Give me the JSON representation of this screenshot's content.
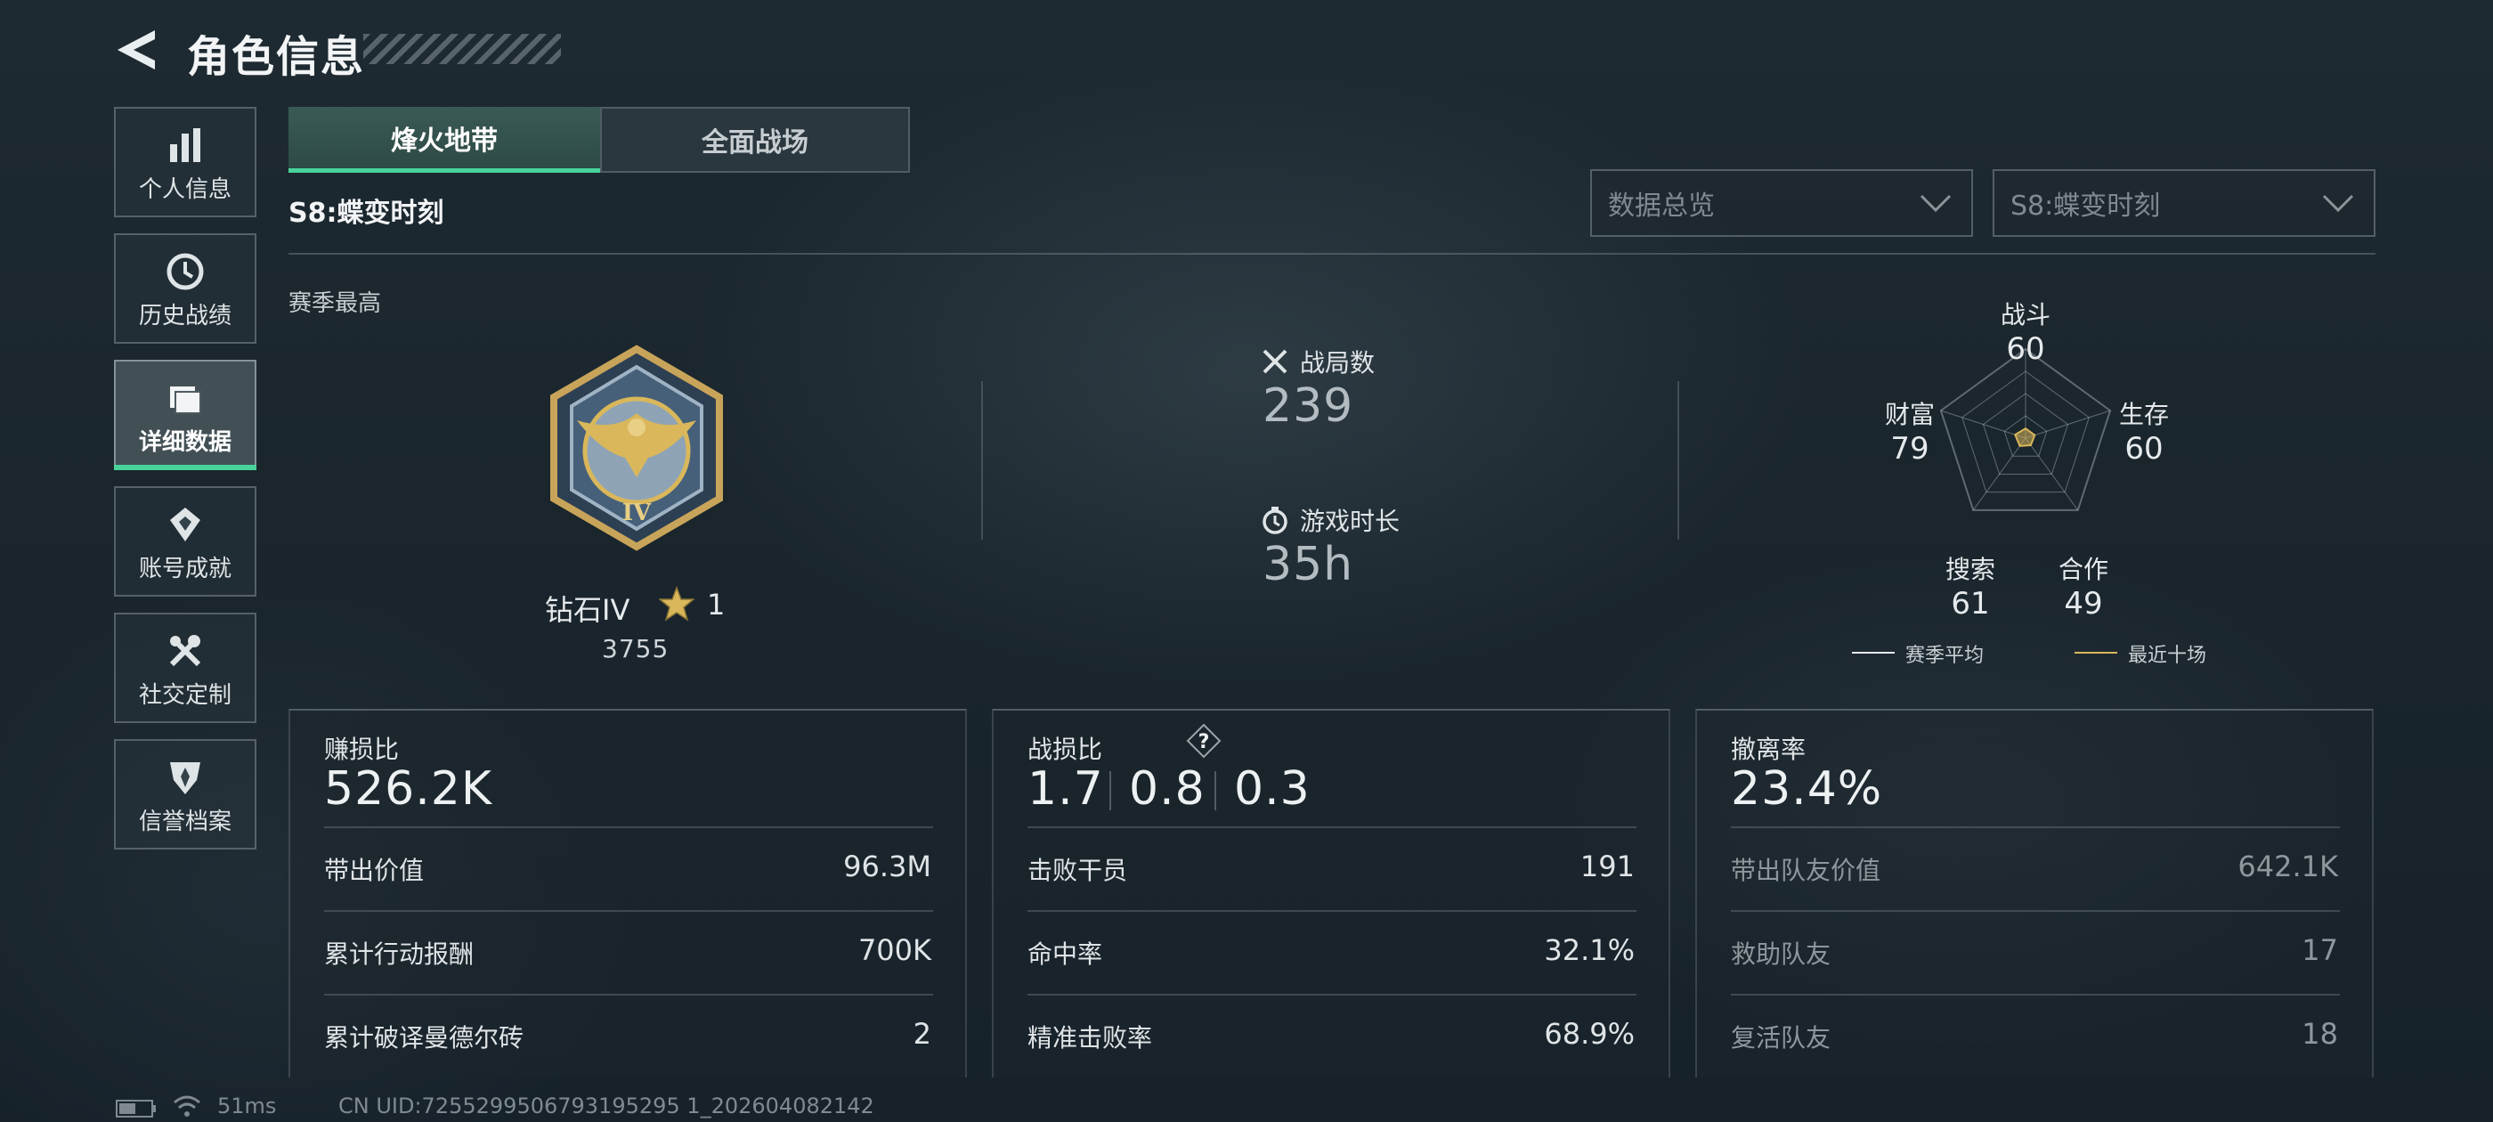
{
  "header": {
    "title": "角色信息"
  },
  "sidebar": {
    "items": [
      {
        "label": "个人信息",
        "icon": "bar-chart-icon"
      },
      {
        "label": "历史战绩",
        "icon": "history-icon"
      },
      {
        "label": "详细数据",
        "icon": "folder-icon",
        "active": true
      },
      {
        "label": "账号成就",
        "icon": "achievement-icon"
      },
      {
        "label": "社交定制",
        "icon": "tools-icon"
      },
      {
        "label": "信誉档案",
        "icon": "reputation-icon"
      }
    ]
  },
  "tabs": [
    {
      "label": "烽火地带",
      "active": true
    },
    {
      "label": "全面战场",
      "active": false
    }
  ],
  "season": {
    "title": "S8:蝶变时刻",
    "best_label": "赛季最高"
  },
  "filters": {
    "data_view": "数据总览",
    "season": "S8:蝶变时刻"
  },
  "rank": {
    "name": "钻石IV",
    "stars": "1",
    "score": "3755",
    "medal_numeral": "IV"
  },
  "summary": {
    "matches_label": "战局数",
    "matches_value": "239",
    "playtime_label": "游戏时长",
    "playtime_value": "35h"
  },
  "radar": {
    "axes": [
      {
        "label": "战斗",
        "value": 60
      },
      {
        "label": "生存",
        "value": 60
      },
      {
        "label": "合作",
        "value": 49
      },
      {
        "label": "搜索",
        "value": 61
      },
      {
        "label": "财富",
        "value": 79
      }
    ],
    "legend": [
      {
        "label": "赛季平均",
        "color": "#e6eaec"
      },
      {
        "label": "最近十场",
        "color": "#d9b75a"
      }
    ]
  },
  "cards": {
    "profit": {
      "label": "赚损比",
      "value": "526.2K",
      "rows": [
        {
          "label": "带出价值",
          "value": "96.3M"
        },
        {
          "label": "累计行动报酬",
          "value": "700K"
        },
        {
          "label": "累计破译曼德尔砖",
          "value": "2"
        }
      ]
    },
    "combat": {
      "label": "战损比",
      "values": [
        "1.7",
        "0.8",
        "0.3"
      ],
      "rows": [
        {
          "label": "击败干员",
          "value": "191"
        },
        {
          "label": "命中率",
          "value": "32.1%"
        },
        {
          "label": "精准击败率",
          "value": "68.9%"
        }
      ]
    },
    "extract": {
      "label": "撤离率",
      "value": "23.4%",
      "rows": [
        {
          "label": "带出队友价值",
          "value": "642.1K"
        },
        {
          "label": "救助队友",
          "value": "17"
        },
        {
          "label": "复活队友",
          "value": "18"
        }
      ]
    }
  },
  "footer": {
    "ping": "51ms",
    "uid": "CN UID:7255299506793195295 1_202604082142"
  },
  "colors": {
    "accent": "#49d39a",
    "gold": "#d9b75a"
  }
}
